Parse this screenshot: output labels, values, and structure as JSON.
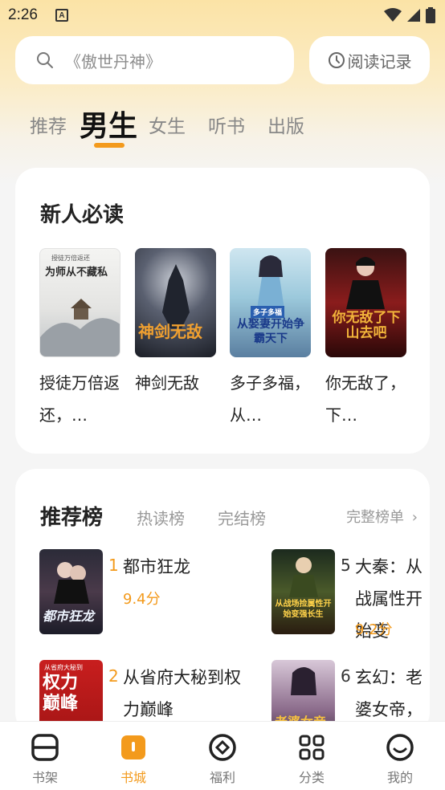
{
  "status_bar": {
    "time": "2:26",
    "notification_letter": "A"
  },
  "search": {
    "placeholder": "《傲世丹神》"
  },
  "history_button": {
    "label": "阅读记录"
  },
  "top_tabs": [
    {
      "label": "推荐"
    },
    {
      "label": "男生",
      "active": true
    },
    {
      "label": "女生"
    },
    {
      "label": "听书"
    },
    {
      "label": "出版"
    }
  ],
  "new_reader": {
    "title": "新人必读",
    "books": [
      {
        "name": "授徒万倍返还，…",
        "cover_text": "为师从不藏私",
        "cover_tag": "授徒万倍返还"
      },
      {
        "name": "神剑无敌",
        "cover_text": "神剑无敌"
      },
      {
        "name": "多子多福，从…",
        "cover_text": "从娶妻开始争霸天下",
        "cover_tag": "多子多福"
      },
      {
        "name": "你无敌了，下…",
        "cover_text": "你无敌了下山去吧"
      }
    ]
  },
  "rankings": {
    "tabs": [
      {
        "label": "推荐榜",
        "active": true
      },
      {
        "label": "热读榜"
      },
      {
        "label": "完结榜"
      }
    ],
    "more_label": "完整榜单",
    "items": [
      {
        "rank": "1",
        "title": "都市狂龙",
        "score": "9.4分",
        "cover_text": "都市狂龙"
      },
      {
        "rank": "5",
        "title": "大秦：从战属性开始变",
        "score": "9.2分",
        "cover_text": "从战场捡属性开始变强长生"
      },
      {
        "rank": "2",
        "title": "从省府大秘到权力巅峰",
        "score": "",
        "cover_text": "权力巅峰",
        "cover_tag": "从省府大秘到"
      },
      {
        "rank": "6",
        "title": "玄幻：老婆女帝，萌娃",
        "score": "",
        "cover_text": "老婆女帝"
      }
    ]
  },
  "bottom_nav": [
    {
      "label": "书架",
      "icon": "bookshelf-icon"
    },
    {
      "label": "书城",
      "icon": "bookstore-icon",
      "active": true
    },
    {
      "label": "福利",
      "icon": "welfare-icon"
    },
    {
      "label": "分类",
      "icon": "category-icon"
    },
    {
      "label": "我的",
      "icon": "profile-icon"
    }
  ],
  "colors": {
    "accent": "#f39a1c",
    "header_gradient_top": "#fbe3a6"
  }
}
